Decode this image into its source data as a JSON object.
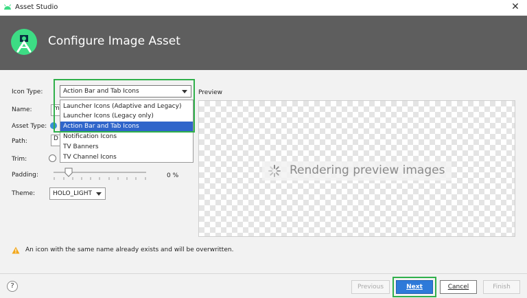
{
  "window": {
    "title": "Asset Studio",
    "close_icon": "close-icon"
  },
  "header": {
    "title": "Configure Image Asset",
    "logo_icon": "android-studio-logo-icon"
  },
  "form": {
    "icon_type_label": "Icon Type:",
    "icon_type_value": "Action Bar and Tab Icons",
    "icon_type_options": [
      "Launcher Icons (Adaptive and Legacy)",
      "Launcher Icons (Legacy only)",
      "Action Bar and Tab Icons",
      "Notification Icons",
      "TV Banners",
      "TV Channel Icons"
    ],
    "name_label": "Name:",
    "name_value_fragment": "m",
    "asset_type_label": "Asset Type:",
    "path_label": "Path:",
    "path_value_fragment": "D",
    "trim_label": "Trim:",
    "padding_label": "Padding:",
    "padding_value": "0 %",
    "theme_label": "Theme:",
    "theme_value": "HOLO_LIGHT"
  },
  "preview": {
    "label": "Preview",
    "status": "Rendering preview images"
  },
  "warning": {
    "text": "An icon with the same name already exists and will be overwritten."
  },
  "buttons": {
    "help": "?",
    "previous": "Previous",
    "next": "Next",
    "cancel": "Cancel",
    "finish": "Finish"
  },
  "colors": {
    "header_bg": "#5e5e5e",
    "selection": "#2f65ca",
    "primary_button": "#2e7ad9",
    "highlight": "#2fb04a",
    "android_green": "#3ddc84"
  }
}
